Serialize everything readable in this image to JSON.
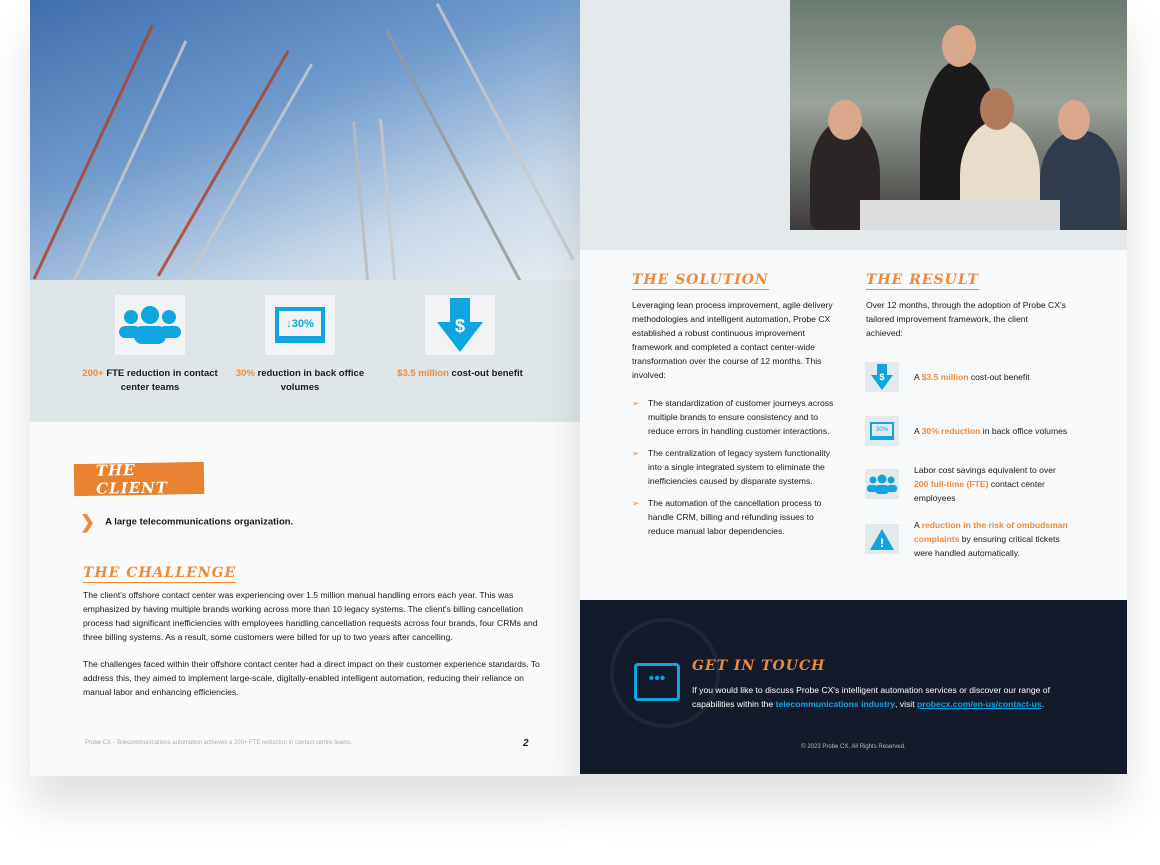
{
  "left_page": {
    "stats": [
      {
        "icon": "people-icon",
        "highlight": "200+",
        "text": " FTE reduction in contact center teams"
      },
      {
        "icon": "laptop-30-percent-icon",
        "icon_text": "↓30%",
        "highlight": "30%",
        "text": " reduction in back office volumes"
      },
      {
        "icon": "dollar-down-arrow-icon",
        "highlight": "$3.5 million",
        "text": " cost-out benefit"
      }
    ],
    "client": {
      "heading": "The Client",
      "text": "A large telecommunications organization."
    },
    "challenge": {
      "heading": "The Challenge",
      "paragraphs": [
        "The client's offshore contact center was experiencing over 1.5 million manual handling errors each year. This was emphasized by having multiple brands working across more than 10 legacy systems. The client's billing cancellation process had significant inefficiencies with employees handling cancellation requests across four brands, four CRMs and three billing systems. As a result, some customers were billed for up to two years after cancelling.",
        "The challenges faced within their offshore contact center had a direct impact on their customer experience standards. To address this, they aimed to implement large-scale, digitally-enabled intelligent automation, reducing their reliance on manual labor and enhancing efficiencies."
      ]
    },
    "footer": "Probe CX - Telecommunications automation achieves a 200+ FTE reduction in contact centre teams.",
    "page_number": "2"
  },
  "right_page": {
    "solution": {
      "heading": "The Solution",
      "intro": "Leveraging lean process improvement, agile delivery methodologies and intelligent automation, Probe CX established a robust continuous improvement framework and completed a contact center-wide transformation over the course of 12 months. This involved:",
      "bullets": [
        "The standardization of customer journeys across multiple brands to ensure consistency and to reduce errors in handling customer interactions.",
        "The centralization of legacy system functionality into a single integrated system to eliminate the inefficiencies caused by disparate systems.",
        "The automation of the cancellation process to handle CRM, billing and refunding issues to reduce manual labor dependencies."
      ]
    },
    "result": {
      "heading": "The Result",
      "intro": "Over 12 months, through the adoption of Probe CX's tailored improvement framework, the client achieved:",
      "items": [
        {
          "icon": "dollar-down-arrow-icon",
          "pre": "A ",
          "highlight": "$3.5 million",
          "post": " cost-out benefit"
        },
        {
          "icon": "laptop-30-percent-icon",
          "pre": "A ",
          "highlight": "30% reduction",
          "post": " in back office volumes"
        },
        {
          "icon": "people-icon",
          "pre": "Labor cost savings equivalent to over ",
          "highlight": "200 full-time (FTE)",
          "post": " contact center employees"
        },
        {
          "icon": "warning-icon",
          "pre": "A ",
          "highlight": "reduction in the risk of ombudsman complaints",
          "post": " by ensuring critical tickets were handled automatically."
        }
      ]
    },
    "contact": {
      "heading": "Get in touch",
      "text1": "If you would like to discuss Probe CX's intelligent automation services or discover our range of capabilities within the ",
      "link1": "telecommunications industry",
      "text2": ", visit ",
      "link2": "probecx.com/en-us/contact-us",
      "text3": "."
    },
    "copyright": "© 2023  Probe CX. All Rights Reserved."
  },
  "colors": {
    "accent": "#ee8a3a",
    "blue": "#0ea5e0",
    "dark": "#131a2a",
    "band": "#dfe6e9"
  }
}
